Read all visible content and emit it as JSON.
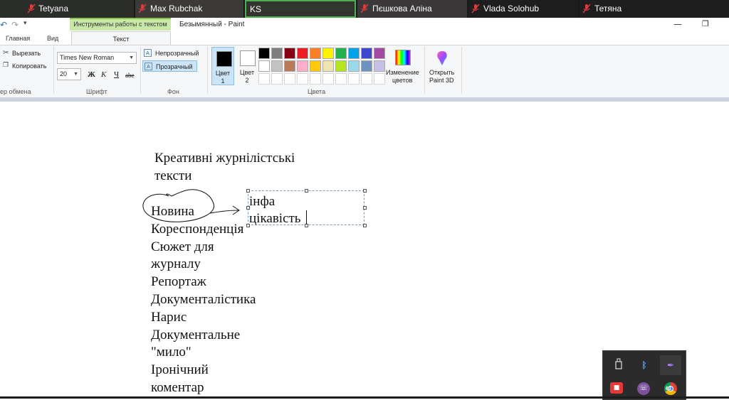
{
  "participants": [
    {
      "name": "Tetyana"
    },
    {
      "name": "Max Rubchak"
    },
    {
      "name": "KS"
    },
    {
      "name": "Пєшкова Аліна"
    },
    {
      "name": "Vlada Solohub"
    },
    {
      "name": "Тетяна"
    }
  ],
  "window": {
    "title": "Безымянный - Paint",
    "context_tab": "Инструменты работы с текстом"
  },
  "ribbon_tabs": {
    "home": "Главная",
    "view": "Вид",
    "text": "Текст"
  },
  "clipboard": {
    "cut": "Вырезать",
    "copy": "Копировать",
    "group_label": "ер обмена"
  },
  "font": {
    "family": "Times New Roman",
    "size": "20",
    "bold": "Ж",
    "italic": "К",
    "underline": "Ч",
    "strike": "abe",
    "group_label": "Шрифт"
  },
  "background": {
    "opaque": "Непрозрачный",
    "transparent": "Прозрачный",
    "group_label": "Фон"
  },
  "colors": {
    "color1_label": "Цвет\n1",
    "color1_line1": "Цвет",
    "color1_line2": "1",
    "color2_line1": "Цвет",
    "color2_line2": "2",
    "color1_value": "#000000",
    "color2_value": "#ffffff",
    "edit_line1": "Изменение",
    "edit_line2": "цветов",
    "paint3d_line1": "Открыть",
    "paint3d_line2": "Paint 3D",
    "group_label": "Цвета",
    "palette_row1": [
      "#000000",
      "#7f7f7f",
      "#880015",
      "#ed1c24",
      "#ff7f27",
      "#fff200",
      "#22b14c",
      "#00a2e8",
      "#3f48cc",
      "#a349a4"
    ],
    "palette_row2": [
      "#ffffff",
      "#c3c3c3",
      "#b97a57",
      "#ffaec9",
      "#ffc90e",
      "#efe4b0",
      "#b5e61d",
      "#99d9ea",
      "#7092be",
      "#c8bfe7"
    ],
    "palette_row3": [
      "#ffffff",
      "#ffffff",
      "#ffffff",
      "#ffffff",
      "#ffffff",
      "#ffffff",
      "#ffffff",
      "#ffffff",
      "#ffffff",
      "#ffffff"
    ]
  },
  "canvas": {
    "heading_line1": "Креативні журнілістські",
    "heading_line2": "тексти",
    "items": [
      "Новина",
      "Кореспонденція",
      "Сюжет для",
      "журналу",
      "Репортаж",
      "Документалістика",
      "Нарис",
      "Документальне",
      "\"мило\"",
      "Іронічний",
      "коментар"
    ],
    "textbox_line1": "інфа",
    "textbox_line2": "цікавість"
  },
  "tray": {
    "icons": [
      "usb-icon",
      "bluetooth-icon",
      "feather-icon",
      "red-app-icon",
      "viber-icon",
      "chrome-icon"
    ],
    "badge": "63"
  }
}
